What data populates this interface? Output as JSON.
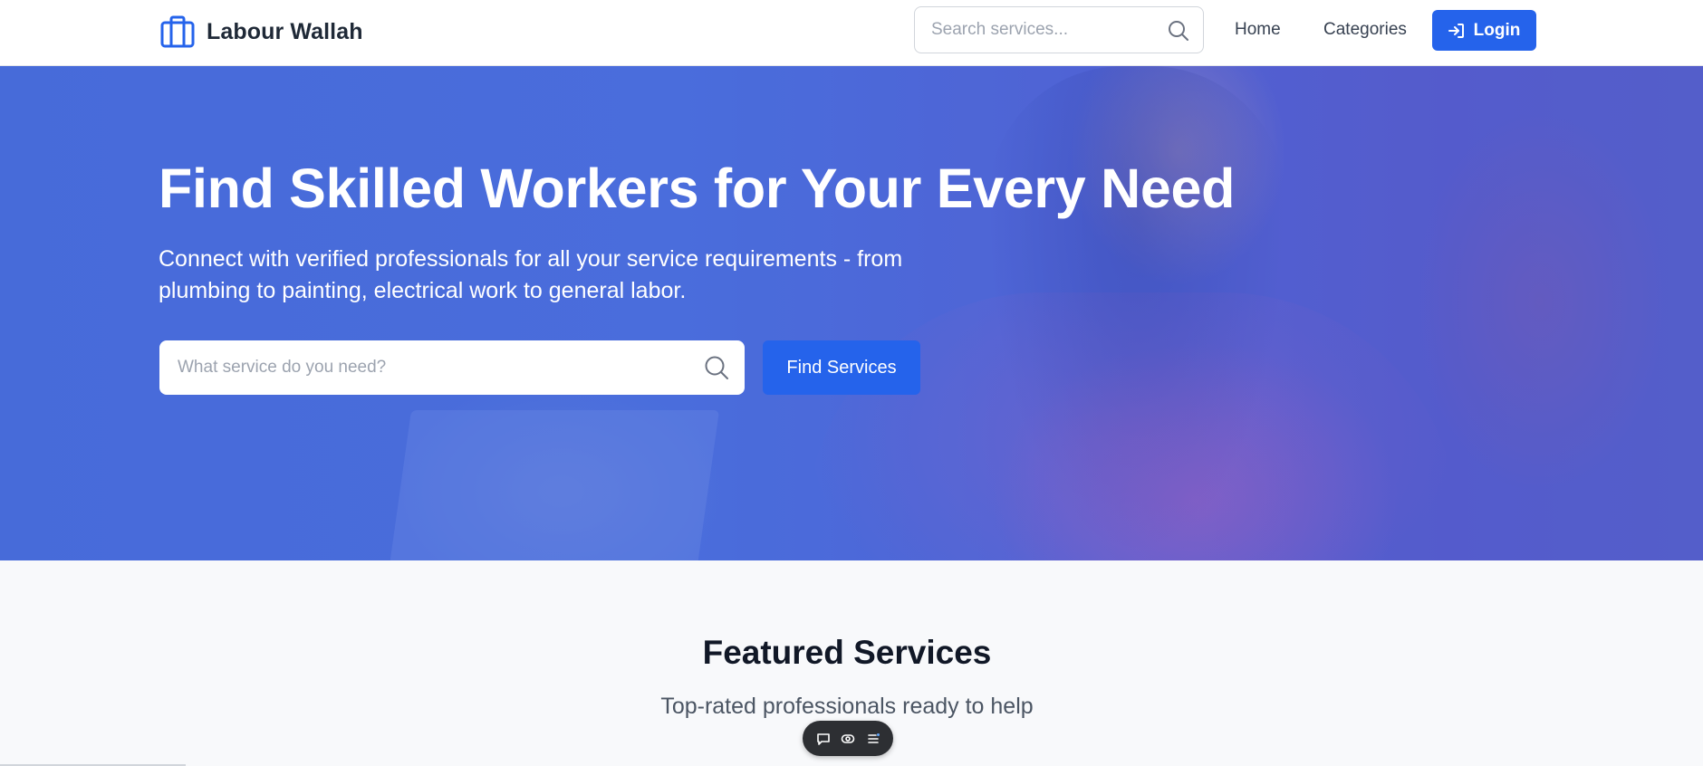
{
  "navbar": {
    "brand_name": "Labour Wallah",
    "search_placeholder": "Search services...",
    "links": [
      {
        "label": "Home"
      },
      {
        "label": "Categories"
      }
    ],
    "login_label": "Login"
  },
  "hero": {
    "title": "Find Skilled Workers for Your Every Need",
    "subtitle": "Connect with verified professionals for all your service requirements - from plumbing to painting, electrical work to general labor.",
    "search_placeholder": "What service do you need?",
    "find_button_label": "Find Services"
  },
  "featured": {
    "title": "Featured Services",
    "subtitle": "Top-rated professionals ready to help"
  },
  "colors": {
    "primary": "#2563eb",
    "hero_overlay": "#4a6fd8",
    "text_dark": "#111827",
    "toolbar_bg": "#2d2f33"
  },
  "icons": {
    "brand": "briefcase-icon",
    "search": "search-icon",
    "login": "login-icon",
    "toolbar": [
      "comment-icon",
      "eye-icon",
      "list-icon"
    ]
  }
}
